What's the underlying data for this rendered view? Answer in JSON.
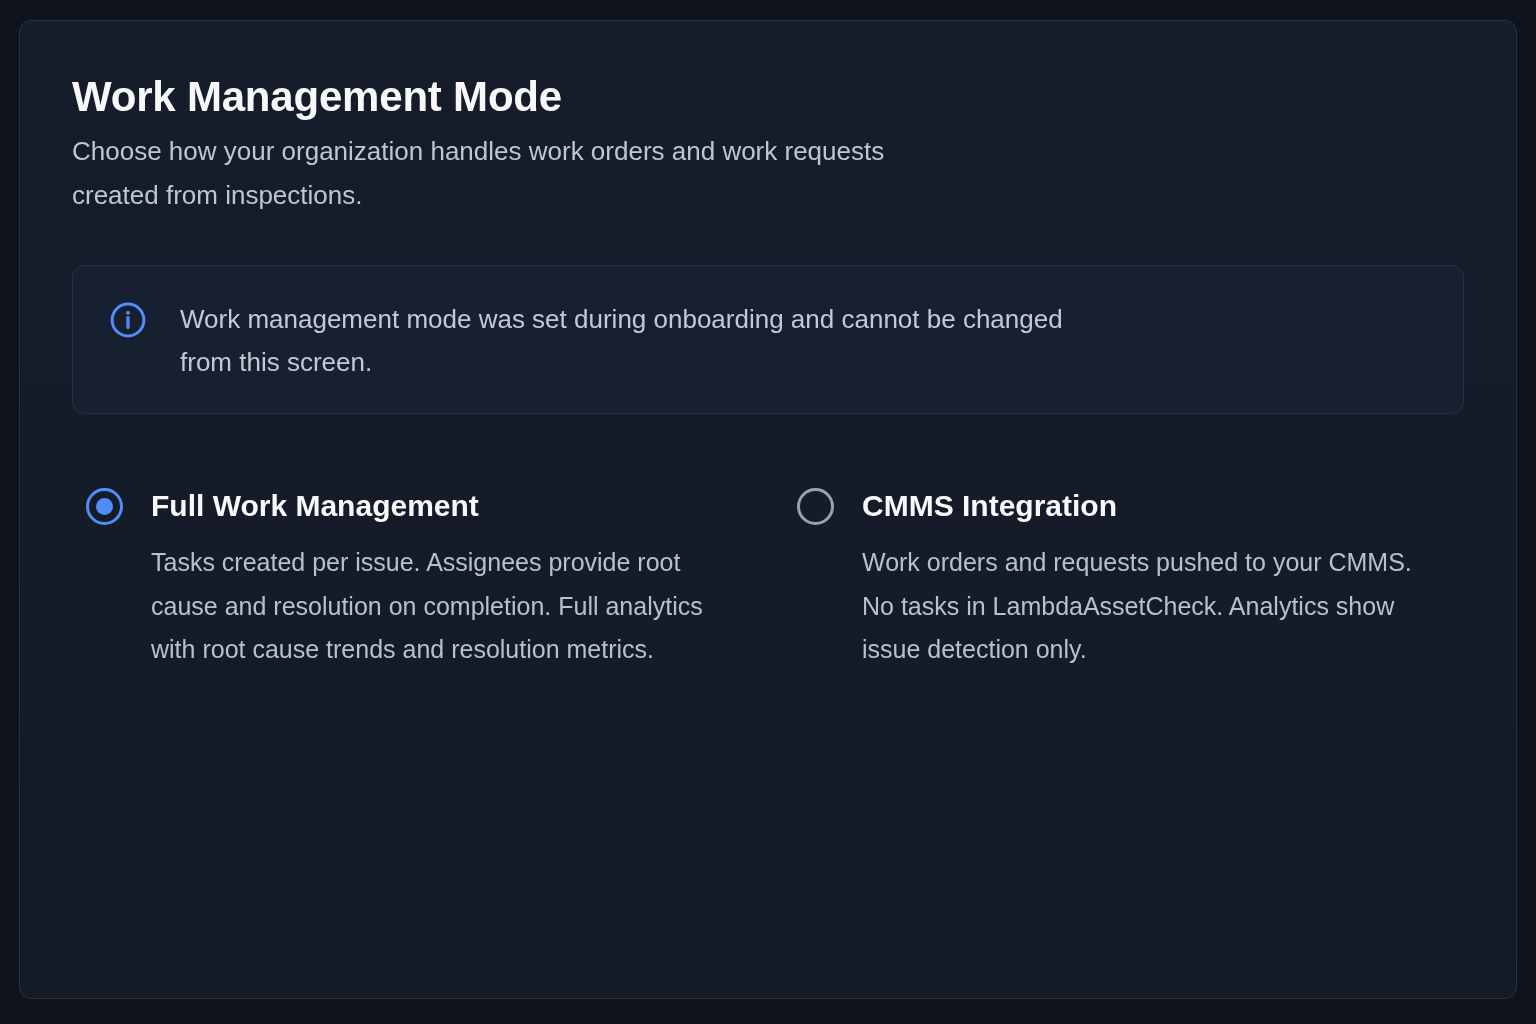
{
  "panel": {
    "title": "Work Management Mode",
    "description": "Choose how your organization handles work orders and work requests created from inspections."
  },
  "notice": {
    "text": "Work management mode was set during onboarding and cannot be changed from this screen."
  },
  "options": [
    {
      "title": "Full Work Management",
      "description": "Tasks created per issue. Assignees provide root cause and resolution on completion. Full analytics with root cause trends and resolution metrics.",
      "selected": true
    },
    {
      "title": "CMMS Integration",
      "description": "Work orders and requests pushed to your CMMS. No tasks in LambdaAssetCheck. Analytics show issue detection only.",
      "selected": false
    }
  ]
}
